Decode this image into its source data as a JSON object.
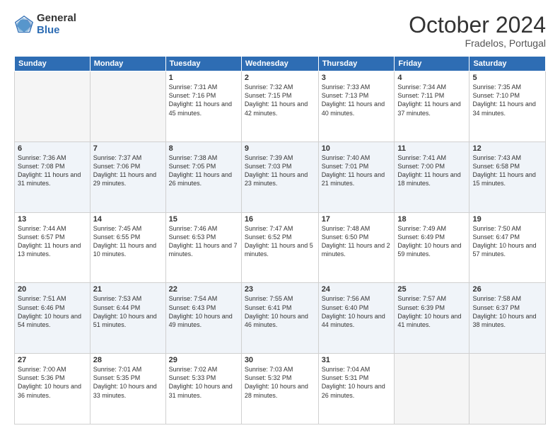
{
  "header": {
    "logo_general": "General",
    "logo_blue": "Blue",
    "title": "October 2024",
    "subtitle": "Fradelos, Portugal"
  },
  "days_of_week": [
    "Sunday",
    "Monday",
    "Tuesday",
    "Wednesday",
    "Thursday",
    "Friday",
    "Saturday"
  ],
  "weeks": [
    [
      {
        "day": "",
        "empty": true
      },
      {
        "day": "",
        "empty": true
      },
      {
        "day": "1",
        "sunrise": "7:31 AM",
        "sunset": "7:16 PM",
        "daylight": "11 hours and 45 minutes."
      },
      {
        "day": "2",
        "sunrise": "7:32 AM",
        "sunset": "7:15 PM",
        "daylight": "11 hours and 42 minutes."
      },
      {
        "day": "3",
        "sunrise": "7:33 AM",
        "sunset": "7:13 PM",
        "daylight": "11 hours and 40 minutes."
      },
      {
        "day": "4",
        "sunrise": "7:34 AM",
        "sunset": "7:11 PM",
        "daylight": "11 hours and 37 minutes."
      },
      {
        "day": "5",
        "sunrise": "7:35 AM",
        "sunset": "7:10 PM",
        "daylight": "11 hours and 34 minutes."
      }
    ],
    [
      {
        "day": "6",
        "sunrise": "7:36 AM",
        "sunset": "7:08 PM",
        "daylight": "11 hours and 31 minutes."
      },
      {
        "day": "7",
        "sunrise": "7:37 AM",
        "sunset": "7:06 PM",
        "daylight": "11 hours and 29 minutes."
      },
      {
        "day": "8",
        "sunrise": "7:38 AM",
        "sunset": "7:05 PM",
        "daylight": "11 hours and 26 minutes."
      },
      {
        "day": "9",
        "sunrise": "7:39 AM",
        "sunset": "7:03 PM",
        "daylight": "11 hours and 23 minutes."
      },
      {
        "day": "10",
        "sunrise": "7:40 AM",
        "sunset": "7:01 PM",
        "daylight": "11 hours and 21 minutes."
      },
      {
        "day": "11",
        "sunrise": "7:41 AM",
        "sunset": "7:00 PM",
        "daylight": "11 hours and 18 minutes."
      },
      {
        "day": "12",
        "sunrise": "7:43 AM",
        "sunset": "6:58 PM",
        "daylight": "11 hours and 15 minutes."
      }
    ],
    [
      {
        "day": "13",
        "sunrise": "7:44 AM",
        "sunset": "6:57 PM",
        "daylight": "11 hours and 13 minutes."
      },
      {
        "day": "14",
        "sunrise": "7:45 AM",
        "sunset": "6:55 PM",
        "daylight": "11 hours and 10 minutes."
      },
      {
        "day": "15",
        "sunrise": "7:46 AM",
        "sunset": "6:53 PM",
        "daylight": "11 hours and 7 minutes."
      },
      {
        "day": "16",
        "sunrise": "7:47 AM",
        "sunset": "6:52 PM",
        "daylight": "11 hours and 5 minutes."
      },
      {
        "day": "17",
        "sunrise": "7:48 AM",
        "sunset": "6:50 PM",
        "daylight": "11 hours and 2 minutes."
      },
      {
        "day": "18",
        "sunrise": "7:49 AM",
        "sunset": "6:49 PM",
        "daylight": "10 hours and 59 minutes."
      },
      {
        "day": "19",
        "sunrise": "7:50 AM",
        "sunset": "6:47 PM",
        "daylight": "10 hours and 57 minutes."
      }
    ],
    [
      {
        "day": "20",
        "sunrise": "7:51 AM",
        "sunset": "6:46 PM",
        "daylight": "10 hours and 54 minutes."
      },
      {
        "day": "21",
        "sunrise": "7:53 AM",
        "sunset": "6:44 PM",
        "daylight": "10 hours and 51 minutes."
      },
      {
        "day": "22",
        "sunrise": "7:54 AM",
        "sunset": "6:43 PM",
        "daylight": "10 hours and 49 minutes."
      },
      {
        "day": "23",
        "sunrise": "7:55 AM",
        "sunset": "6:41 PM",
        "daylight": "10 hours and 46 minutes."
      },
      {
        "day": "24",
        "sunrise": "7:56 AM",
        "sunset": "6:40 PM",
        "daylight": "10 hours and 44 minutes."
      },
      {
        "day": "25",
        "sunrise": "7:57 AM",
        "sunset": "6:39 PM",
        "daylight": "10 hours and 41 minutes."
      },
      {
        "day": "26",
        "sunrise": "7:58 AM",
        "sunset": "6:37 PM",
        "daylight": "10 hours and 38 minutes."
      }
    ],
    [
      {
        "day": "27",
        "sunrise": "7:00 AM",
        "sunset": "5:36 PM",
        "daylight": "10 hours and 36 minutes."
      },
      {
        "day": "28",
        "sunrise": "7:01 AM",
        "sunset": "5:35 PM",
        "daylight": "10 hours and 33 minutes."
      },
      {
        "day": "29",
        "sunrise": "7:02 AM",
        "sunset": "5:33 PM",
        "daylight": "10 hours and 31 minutes."
      },
      {
        "day": "30",
        "sunrise": "7:03 AM",
        "sunset": "5:32 PM",
        "daylight": "10 hours and 28 minutes."
      },
      {
        "day": "31",
        "sunrise": "7:04 AM",
        "sunset": "5:31 PM",
        "daylight": "10 hours and 26 minutes."
      },
      {
        "day": "",
        "empty": true
      },
      {
        "day": "",
        "empty": true
      }
    ]
  ]
}
